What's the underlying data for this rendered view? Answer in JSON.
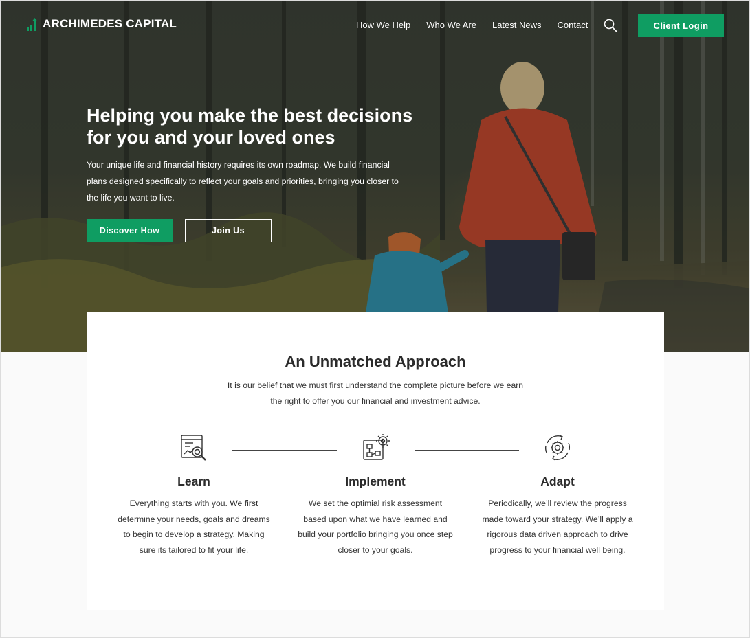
{
  "brand": {
    "name": "ARCHIMEDES CAPITAL",
    "accent_color": "#0f9d62"
  },
  "nav": {
    "links": [
      "How We Help",
      "Who We Are",
      "Latest News",
      "Contact"
    ],
    "search_icon": "search-icon",
    "login_label": "Client Login"
  },
  "hero": {
    "title_line1": "Helping you make the best decisions",
    "title_line2": "for you and your loved ones",
    "body": "Your unique life and financial history requires its own roadmap. We build financial plans designed specifically to reflect your goals and priorities, bringing you closer to the life you want to live.",
    "primary_button": "Discover How",
    "secondary_button": "Join Us"
  },
  "approach": {
    "title": "An Unmatched Approach",
    "subtitle": "It is our belief that we must first understand the complete picture before we earn the right to offer you our financial and investment advice.",
    "steps": [
      {
        "icon": "learn-analysis-icon",
        "title": "Learn",
        "body": "Everything starts with you. We first determine your needs, goals and dreams to begin to develop a strategy. Making sure its tailored to fit your life."
      },
      {
        "icon": "implement-blueprint-gear-icon",
        "title": "Implement",
        "body": "We set the optimial risk assessment based upon what we have learned and build your portfolio bringing you once step closer to your goals."
      },
      {
        "icon": "adapt-cycle-gear-icon",
        "title": "Adapt",
        "body": "Periodically, we’ll review the progress made toward your strategy. We’ll apply a rigorous data driven approach to drive progress to your financial well being."
      }
    ]
  }
}
